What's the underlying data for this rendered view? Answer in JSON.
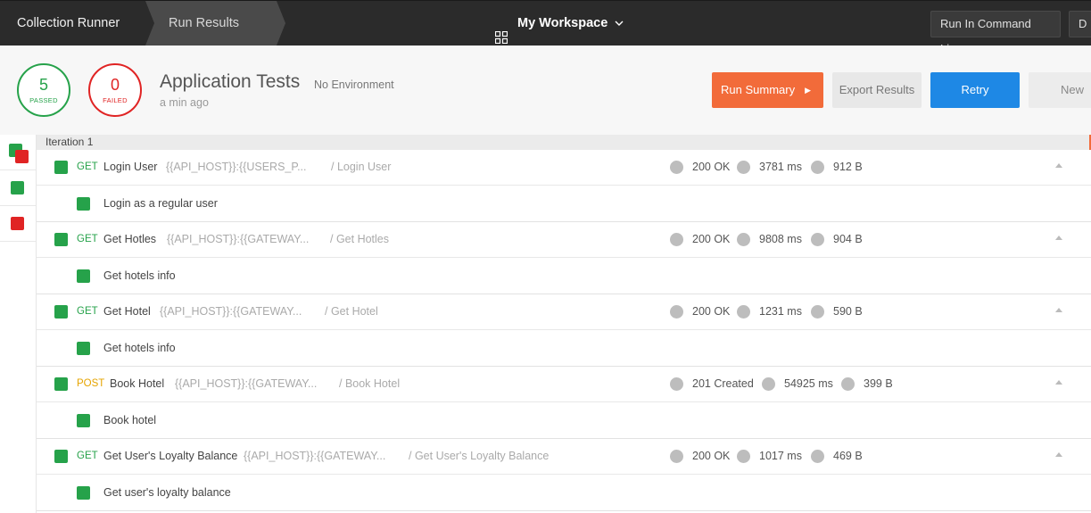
{
  "topbar": {
    "crumbs": [
      "Collection Runner",
      "Run Results"
    ],
    "workspace": "My Workspace",
    "run_cli": "Run In Command Line",
    "extra": "D"
  },
  "summary": {
    "passed_count": "5",
    "passed_label": "PASSED",
    "failed_count": "0",
    "failed_label": "FAILED",
    "title": "Application Tests",
    "environment": "No Environment",
    "time_ago": "a min ago",
    "buttons": {
      "run_summary": "Run Summary",
      "export": "Export Results",
      "retry": "Retry",
      "new": "New"
    }
  },
  "iteration": "Iteration 1",
  "requests": [
    {
      "method": "GET",
      "name": "Login User",
      "url": "{{API_HOST}}:{{USERS_P...",
      "path": "/ Login User",
      "status": "200 OK",
      "time": "3781 ms",
      "size": "912 B",
      "test": "Login as a regular user"
    },
    {
      "method": "GET",
      "name": "Get Hotles",
      "url": "{{API_HOST}}:{{GATEWAY...",
      "path": "/ Get Hotles",
      "status": "200 OK",
      "time": "9808 ms",
      "size": "904 B",
      "test": "Get hotels info"
    },
    {
      "method": "GET",
      "name": "Get Hotel",
      "url": "{{API_HOST}}:{{GATEWAY...",
      "path": "/ Get Hotel",
      "status": "200 OK",
      "time": "1231 ms",
      "size": "590 B",
      "test": "Get hotels info"
    },
    {
      "method": "POST",
      "name": "Book Hotel",
      "url": "{{API_HOST}}:{{GATEWAY...",
      "path": "/ Book Hotel",
      "status": "201 Created",
      "time": "54925 ms",
      "size": "399 B",
      "test": "Book hotel"
    },
    {
      "method": "GET",
      "name": "Get User's Loyalty Balance",
      "url": "{{API_HOST}}:{{GATEWAY...",
      "path": "/ Get User's Loyalty Balance",
      "status": "200 OK",
      "time": "1017 ms",
      "size": "469 B",
      "test": "Get user's loyalty balance"
    }
  ],
  "colors": {
    "pass": "#26a24a",
    "fail": "#e02424",
    "post": "#e6a400",
    "accent": "#f26b3a",
    "primary": "#1e88e5"
  }
}
